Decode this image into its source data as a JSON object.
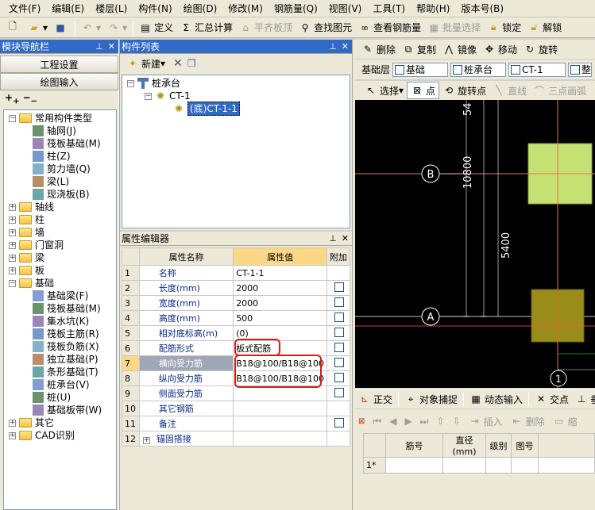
{
  "menu": [
    "文件(F)",
    "编辑(E)",
    "楼层(L)",
    "构件(N)",
    "绘图(D)",
    "修改(M)",
    "钢筋量(Q)",
    "视图(V)",
    "工具(T)",
    "帮助(H)",
    "版本号(B)"
  ],
  "toolbar": {
    "define": "定义",
    "sum_calc": "汇总计算",
    "flat_plate": "平齐板顶",
    "find_element": "查找图元",
    "view_rebar": "查看钢筋量",
    "batch_select": "批量选择",
    "lock": "锁定",
    "unlock": "解锁"
  },
  "toolbar2": {
    "delete": "删除",
    "copy": "复制",
    "mirror": "镜像",
    "move": "移动",
    "rotate": "旋转"
  },
  "layer_bar": {
    "layer_label": "基础层",
    "layer_value": "基础",
    "type_value": "桩承台",
    "element_value": "CT-1",
    "extra": "整"
  },
  "select_bar": {
    "select": "选择",
    "point": "点",
    "rotate_point": "旋转点",
    "line": "直线",
    "three_point_arc": "三点画弧"
  },
  "nav_panel": {
    "title": "模块导航栏",
    "project_settings": "工程设置",
    "drawing_input": "绘图输入",
    "tree": [
      {
        "level": 0,
        "type": "folder",
        "expanded": true,
        "label": "常用构件类型"
      },
      {
        "level": 1,
        "type": "item",
        "label": "轴网(J)"
      },
      {
        "level": 1,
        "type": "item",
        "label": "筏板基础(M)"
      },
      {
        "level": 1,
        "type": "item",
        "label": "柱(Z)"
      },
      {
        "level": 1,
        "type": "item",
        "label": "剪力墙(Q)"
      },
      {
        "level": 1,
        "type": "item",
        "label": "梁(L)"
      },
      {
        "level": 1,
        "type": "item",
        "label": "现浇板(B)"
      },
      {
        "level": 0,
        "type": "folder",
        "expanded": false,
        "label": "轴线"
      },
      {
        "level": 0,
        "type": "folder",
        "expanded": false,
        "label": "柱"
      },
      {
        "level": 0,
        "type": "folder",
        "expanded": false,
        "label": "墙"
      },
      {
        "level": 0,
        "type": "folder",
        "expanded": false,
        "label": "门窗洞"
      },
      {
        "level": 0,
        "type": "folder",
        "expanded": false,
        "label": "梁"
      },
      {
        "level": 0,
        "type": "folder",
        "expanded": false,
        "label": "板"
      },
      {
        "level": 0,
        "type": "folder",
        "expanded": true,
        "label": "基础"
      },
      {
        "level": 1,
        "type": "item",
        "label": "基础梁(F)"
      },
      {
        "level": 1,
        "type": "item",
        "label": "筏板基础(M)"
      },
      {
        "level": 1,
        "type": "item",
        "label": "集水坑(K)"
      },
      {
        "level": 1,
        "type": "item",
        "label": "筏板主筋(R)"
      },
      {
        "level": 1,
        "type": "item",
        "label": "筏板负筋(X)"
      },
      {
        "level": 1,
        "type": "item",
        "label": "独立基础(P)"
      },
      {
        "level": 1,
        "type": "item",
        "label": "条形基础(T)"
      },
      {
        "level": 1,
        "type": "item",
        "label": "桩承台(V)"
      },
      {
        "level": 1,
        "type": "item",
        "label": "桩(U)"
      },
      {
        "level": 1,
        "type": "item",
        "label": "基础板带(W)"
      },
      {
        "level": 0,
        "type": "folder",
        "expanded": false,
        "label": "其它"
      },
      {
        "level": 0,
        "type": "folder",
        "expanded": false,
        "label": "CAD识别"
      }
    ]
  },
  "component_list": {
    "title": "构件列表",
    "new_button": "新建",
    "tree": [
      {
        "level": 0,
        "label": "桩承台"
      },
      {
        "level": 1,
        "label": "CT-1"
      },
      {
        "level": 2,
        "label": "(底)CT-1-1"
      }
    ]
  },
  "property_editor": {
    "title": "属性编辑器",
    "headers": [
      "属性名称",
      "属性值",
      "附加"
    ],
    "rows": [
      {
        "num": "1",
        "name": "名称",
        "value": "CT-1-1",
        "checkbox": false
      },
      {
        "num": "2",
        "name": "长度(mm)",
        "value": "2000",
        "checkbox": true
      },
      {
        "num": "3",
        "name": "宽度(mm)",
        "value": "2000",
        "checkbox": true
      },
      {
        "num": "4",
        "name": "高度(mm)",
        "value": "500",
        "checkbox": true
      },
      {
        "num": "5",
        "name": "相对底标高(m)",
        "value": "(0)",
        "checkbox": true
      },
      {
        "num": "6",
        "name": "配筋形式",
        "value": "板式配筋",
        "checkbox": true
      },
      {
        "num": "7",
        "name": "横向受力筋",
        "value": "B18@100/B18@100",
        "checkbox": true
      },
      {
        "num": "8",
        "name": "纵向受力筋",
        "value": "B18@100/B18@100",
        "checkbox": true
      },
      {
        "num": "9",
        "name": "侧面受力筋",
        "value": "",
        "checkbox": true
      },
      {
        "num": "10",
        "name": "其它钢筋",
        "value": "",
        "checkbox": false
      },
      {
        "num": "11",
        "name": "备注",
        "value": "",
        "checkbox": true
      },
      {
        "num": "12",
        "name": "锚固搭接",
        "value": "",
        "checkbox": false
      }
    ]
  },
  "canvas": {
    "axis_b": "B",
    "axis_a": "A",
    "axis_1": "1",
    "dim_top": "54",
    "dim_mid": "10800",
    "dim_low": "5400"
  },
  "status_bar": {
    "ortho": "正交",
    "snap": "对象捕捉",
    "dynamic_input": "动态输入",
    "intersection": "交点",
    "perp": "垂"
  },
  "rebar_grid": {
    "insert": "插入",
    "delete": "删除",
    "extra": "缩",
    "headers": [
      "筋号",
      "直径(mm)",
      "级别",
      "图号"
    ],
    "first_row": "1*"
  }
}
